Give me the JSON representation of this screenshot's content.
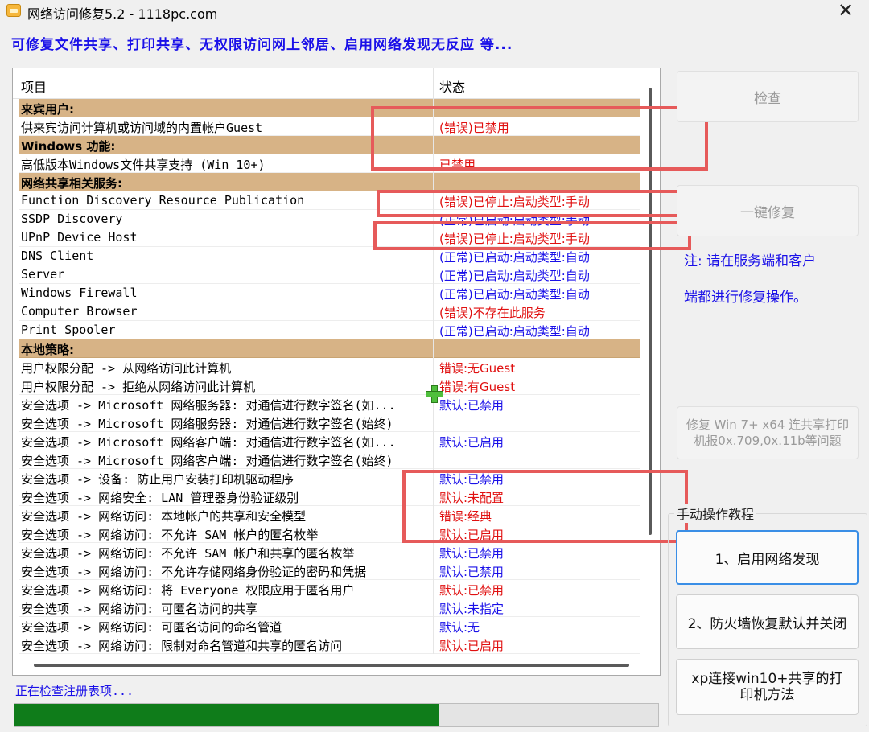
{
  "window": {
    "title": "网络访问修复5.2 - 1118pc.com",
    "close_glyph": "✕"
  },
  "banner": "可修复文件共享、打印共享、无权限访问网上邻居、启用网络发现无反应  等...",
  "list": {
    "columns": {
      "item": "项目",
      "status": "状态"
    },
    "rows": [
      {
        "type": "section",
        "item": "来宾用户:",
        "status": ""
      },
      {
        "type": "row",
        "item": "供来宾访问计算机或访问域的内置帐户Guest",
        "status": "(错误)已禁用",
        "color": "red"
      },
      {
        "type": "section",
        "item": "Windows 功能:",
        "status": ""
      },
      {
        "type": "row",
        "item": "高低版本Windows文件共享支持 (Win 10+)",
        "status": "已禁用",
        "color": "red"
      },
      {
        "type": "section",
        "item": "网络共享相关服务:",
        "status": ""
      },
      {
        "type": "row",
        "item": "Function Discovery Resource Publication",
        "status": "(错误)已停止:启动类型:手动",
        "color": "red"
      },
      {
        "type": "row",
        "item": "SSDP Discovery",
        "status": "(正常)已启动:启动类型:手动",
        "color": "blue"
      },
      {
        "type": "row",
        "item": "UPnP Device Host",
        "status": "(错误)已停止:启动类型:手动",
        "color": "red"
      },
      {
        "type": "row",
        "item": "DNS Client",
        "status": "(正常)已启动:启动类型:自动",
        "color": "blue"
      },
      {
        "type": "row",
        "item": "Server",
        "status": "(正常)已启动:启动类型:自动",
        "color": "blue"
      },
      {
        "type": "row",
        "item": "Windows Firewall",
        "status": "(正常)已启动:启动类型:自动",
        "color": "blue"
      },
      {
        "type": "row",
        "item": "Computer Browser",
        "status": "(错误)不存在此服务",
        "color": "red"
      },
      {
        "type": "row",
        "item": "Print Spooler",
        "status": "(正常)已启动:启动类型:自动",
        "color": "blue"
      },
      {
        "type": "section",
        "item": "本地策略:",
        "status": ""
      },
      {
        "type": "row",
        "item": "用户权限分配 -> 从网络访问此计算机",
        "status": "错误:无Guest",
        "color": "red"
      },
      {
        "type": "row",
        "item": "用户权限分配 -> 拒绝从网络访问此计算机",
        "status": "错误:有Guest",
        "color": "red"
      },
      {
        "type": "row",
        "item": "安全选项 -> Microsoft 网络服务器: 对通信进行数字签名(如...",
        "status": "默认:已禁用",
        "color": "blue"
      },
      {
        "type": "row",
        "item": "安全选项 -> Microsoft 网络服务器: 对通信进行数字签名(始终)",
        "status": "",
        "color": "blue"
      },
      {
        "type": "row",
        "item": "安全选项 -> Microsoft 网络客户端: 对通信进行数字签名(如...",
        "status": "默认:已启用",
        "color": "blue"
      },
      {
        "type": "row",
        "item": "安全选项 -> Microsoft 网络客户端: 对通信进行数字签名(始终)",
        "status": "",
        "color": "blue"
      },
      {
        "type": "row",
        "item": "安全选项 -> 设备: 防止用户安装打印机驱动程序",
        "status": "默认:已禁用",
        "color": "blue"
      },
      {
        "type": "row",
        "item": "安全选项 -> 网络安全: LAN 管理器身份验证级别",
        "status": "默认:未配置",
        "color": "red"
      },
      {
        "type": "row",
        "item": "安全选项 -> 网络访问: 本地帐户的共享和安全模型",
        "status": "错误:经典",
        "color": "red"
      },
      {
        "type": "row",
        "item": "安全选项 -> 网络访问: 不允许 SAM 帐户的匿名枚举",
        "status": "默认:已启用",
        "color": "red"
      },
      {
        "type": "row",
        "item": "安全选项 -> 网络访问: 不允许 SAM 帐户和共享的匿名枚举",
        "status": "默认:已禁用",
        "color": "blue"
      },
      {
        "type": "row",
        "item": "安全选项 -> 网络访问: 不允许存储网络身份验证的密码和凭据",
        "status": "默认:已禁用",
        "color": "blue"
      },
      {
        "type": "row",
        "item": "安全选项 -> 网络访问: 将 Everyone 权限应用于匿名用户",
        "status": "默认:已禁用",
        "color": "red"
      },
      {
        "type": "row",
        "item": "安全选项 -> 网络访问: 可匿名访问的共享",
        "status": "默认:未指定",
        "color": "blue"
      },
      {
        "type": "row",
        "item": "安全选项 -> 网络访问: 可匿名访问的命名管道",
        "status": "默认:无",
        "color": "blue"
      },
      {
        "type": "row",
        "item": "安全选项 -> 网络访问: 限制对命名管道和共享的匿名访问",
        "status": "默认:已启用",
        "color": "red"
      }
    ]
  },
  "buttons": {
    "check": "检查",
    "one_click_fix": "一键修复",
    "fix_printer": "修复 Win 7+ x64 连共享打印机报0x.709,0x.11b等问题",
    "enable_discovery": "1、启用网络发现",
    "firewall_restore": "2、防火墙恢复默认并关闭",
    "xp_connect": "xp连接win10+共享的打印机方法"
  },
  "note": {
    "line1": "注: 请在服务端和客户",
    "line2": "端都进行修复操作。"
  },
  "manual_group": {
    "label": "手动操作教程"
  },
  "status": {
    "text": "正在检查注册表项...",
    "progress_fraction": 0.66
  },
  "colors": {
    "red": "#e01010",
    "blue": "#1a10e8",
    "section": "#d7b386",
    "progress": "#0f7c1a",
    "annotation": "#e65a5a"
  }
}
